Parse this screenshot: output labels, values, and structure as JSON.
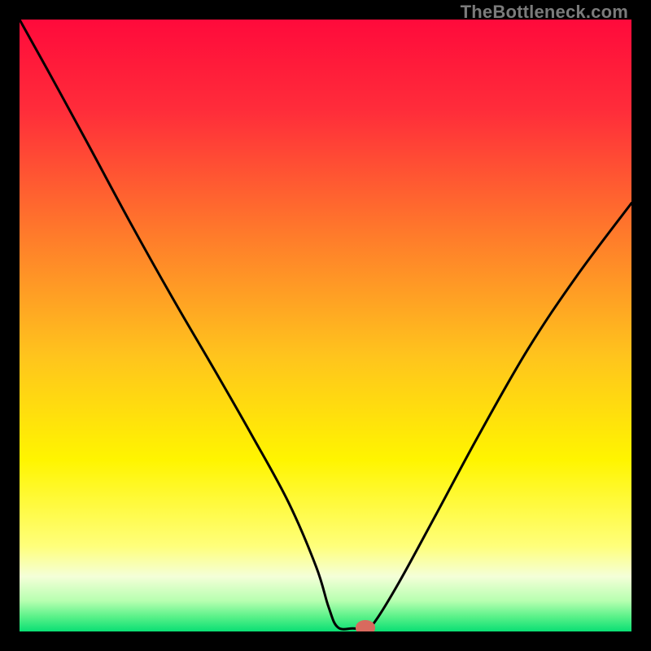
{
  "attribution": "TheBottleneck.com",
  "chart_data": {
    "type": "line",
    "title": "",
    "xlabel": "",
    "ylabel": "",
    "xlim": [
      0,
      100
    ],
    "ylim": [
      0,
      100
    ],
    "gradient_stops": [
      {
        "pct": 0.0,
        "color": "#ff0a3b"
      },
      {
        "pct": 0.15,
        "color": "#ff2d3a"
      },
      {
        "pct": 0.35,
        "color": "#ff7a2b"
      },
      {
        "pct": 0.55,
        "color": "#ffc41d"
      },
      {
        "pct": 0.72,
        "color": "#fff500"
      },
      {
        "pct": 0.86,
        "color": "#ffff7a"
      },
      {
        "pct": 0.91,
        "color": "#f4ffd8"
      },
      {
        "pct": 0.95,
        "color": "#b7ffb0"
      },
      {
        "pct": 0.975,
        "color": "#5df28a"
      },
      {
        "pct": 1.0,
        "color": "#0adf74"
      }
    ],
    "series": [
      {
        "name": "bottleneck-curve",
        "points": [
          {
            "x": 0.0,
            "y": 100.0
          },
          {
            "x": 5.0,
            "y": 91.0
          },
          {
            "x": 11.0,
            "y": 80.0
          },
          {
            "x": 18.0,
            "y": 67.0
          },
          {
            "x": 25.0,
            "y": 54.5
          },
          {
            "x": 32.0,
            "y": 42.5
          },
          {
            "x": 38.0,
            "y": 32.0
          },
          {
            "x": 44.0,
            "y": 21.0
          },
          {
            "x": 48.5,
            "y": 10.5
          },
          {
            "x": 50.5,
            "y": 4.0
          },
          {
            "x": 52.0,
            "y": 0.7
          },
          {
            "x": 54.5,
            "y": 0.5
          },
          {
            "x": 56.5,
            "y": 0.5
          },
          {
            "x": 58.0,
            "y": 1.5
          },
          {
            "x": 62.0,
            "y": 8.0
          },
          {
            "x": 68.0,
            "y": 19.0
          },
          {
            "x": 75.0,
            "y": 32.0
          },
          {
            "x": 83.0,
            "y": 46.0
          },
          {
            "x": 91.0,
            "y": 58.0
          },
          {
            "x": 100.0,
            "y": 70.0
          }
        ]
      }
    ],
    "marker": {
      "x": 56.5,
      "y": 0.6,
      "rx": 1.6,
      "ry": 1.2,
      "color": "#d86a5e"
    }
  }
}
